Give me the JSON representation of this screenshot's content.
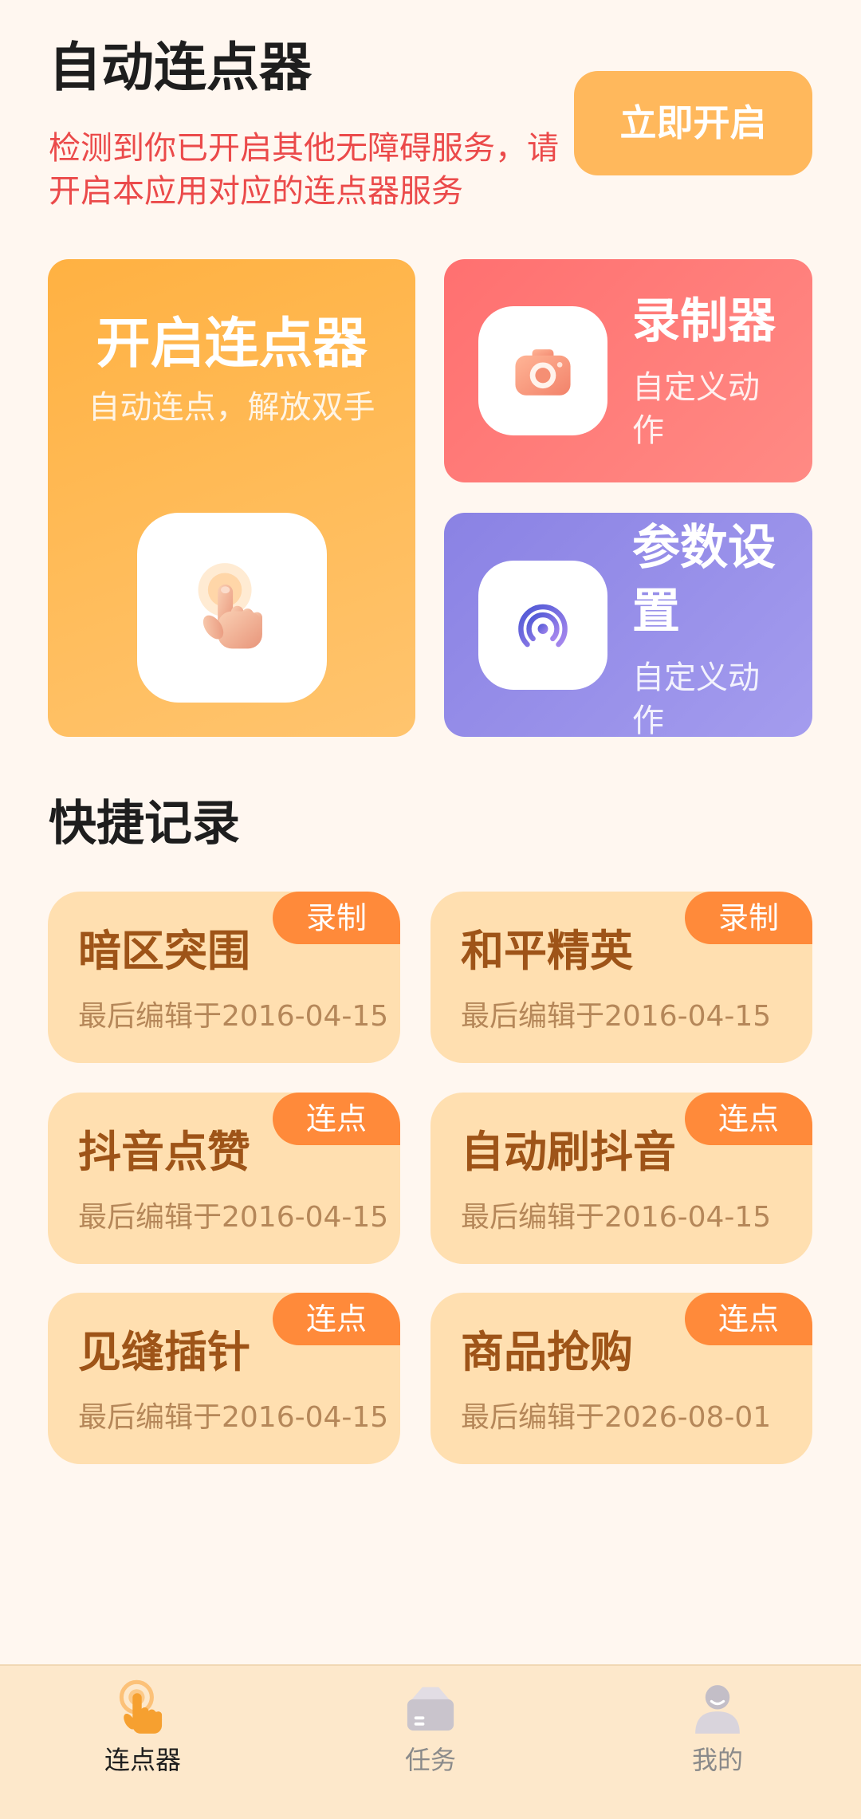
{
  "app": {
    "title": "自动连点器"
  },
  "notice": {
    "text": "检测到你已开启其他无障碍服务，请开启本应用对应的连点器服务"
  },
  "enable_button": {
    "label": "立即开启"
  },
  "feature_cards": {
    "clicker": {
      "title": "开启连点器",
      "subtitle": "自动连点，解放双手",
      "icon": "tap-hand-icon"
    },
    "recorder": {
      "title": "录制器",
      "subtitle": "自定义动作",
      "icon": "camera-icon"
    },
    "settings": {
      "title": "参数设置",
      "subtitle": "自定义动作",
      "icon": "broadcast-icon"
    }
  },
  "quick_records": {
    "title": "快捷记录",
    "items": [
      {
        "title": "暗区突围",
        "tag": "录制",
        "edited": "最后编辑于2016-04-15"
      },
      {
        "title": "和平精英",
        "tag": "录制",
        "edited": "最后编辑于2016-04-15"
      },
      {
        "title": "抖音点赞",
        "tag": "连点",
        "edited": "最后编辑于2016-04-15"
      },
      {
        "title": "自动刷抖音",
        "tag": "连点",
        "edited": "最后编辑于2016-04-15"
      },
      {
        "title": "见缝插针",
        "tag": "连点",
        "edited": "最后编辑于2016-04-15"
      },
      {
        "title": "商品抢购",
        "tag": "连点",
        "edited": "最后编辑于2026-08-01"
      }
    ]
  },
  "tab_bar": {
    "tabs": [
      {
        "label": "连点器",
        "icon": "tap-hand-icon",
        "active": true
      },
      {
        "label": "任务",
        "icon": "task-box-icon",
        "active": false
      },
      {
        "label": "我的",
        "icon": "profile-icon",
        "active": false
      }
    ]
  },
  "colors": {
    "background": "#FFF7F0",
    "accent": "#FFB85C",
    "warning_text": "#EB4A4A",
    "recorder_card": "#FF7B7B",
    "settings_card": "#9A90E8",
    "record_card": "#FFDFB0",
    "record_tag": "#FF8A3A",
    "tab_bar": "#FDE8CB"
  }
}
